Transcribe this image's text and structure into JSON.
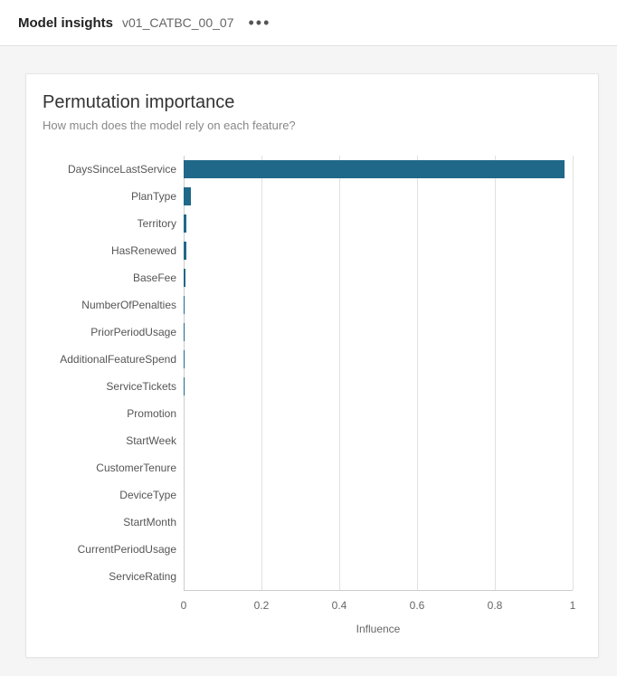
{
  "header": {
    "title": "Model insights",
    "subtitle": "v01_CATBC_00_07"
  },
  "card": {
    "title": "Permutation importance",
    "subtitle": "How much does the model rely on each feature?",
    "xlabel": "Influence"
  },
  "chart_data": {
    "type": "bar",
    "orientation": "horizontal",
    "title": "Permutation importance",
    "xlabel": "Influence",
    "ylabel": "",
    "xlim": [
      0,
      1
    ],
    "x_ticks": [
      0,
      0.2,
      0.4,
      0.6,
      0.8,
      1
    ],
    "categories": [
      "DaysSinceLastService",
      "PlanType",
      "Territory",
      "HasRenewed",
      "BaseFee",
      "NumberOfPenalties",
      "PriorPeriodUsage",
      "AdditionalFeatureSpend",
      "ServiceTickets",
      "Promotion",
      "StartWeek",
      "CustomerTenure",
      "DeviceType",
      "StartMonth",
      "CurrentPeriodUsage",
      "ServiceRating"
    ],
    "values": [
      0.98,
      0.018,
      0.008,
      0.007,
      0.004,
      0.001,
      0.001,
      0.001,
      0.001,
      0.0,
      0.0,
      0.0,
      0.0,
      0.0,
      0.0,
      0.0
    ]
  },
  "colors": {
    "bar": "#1f6889"
  }
}
